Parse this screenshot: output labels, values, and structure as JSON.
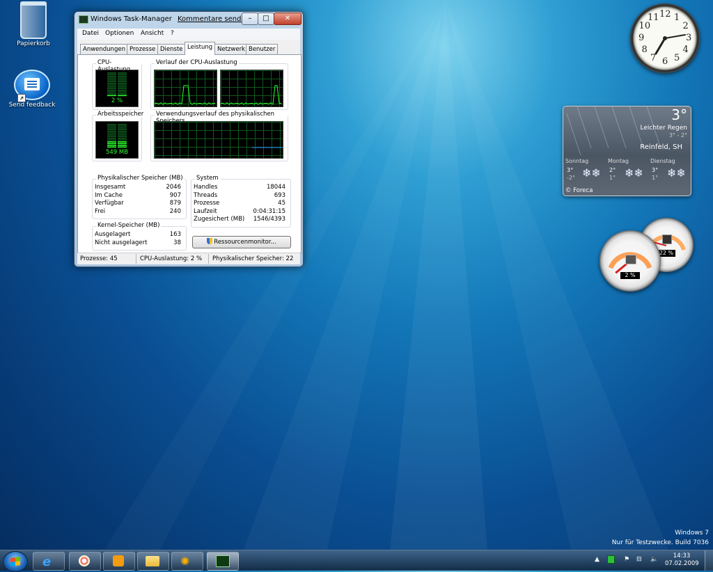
{
  "desktop": {
    "icons": [
      {
        "label": "Papierkorb"
      },
      {
        "label": "Send feedback"
      }
    ],
    "watermark": {
      "line1": "Windows 7",
      "line2": "Nur für Testzwecke. Build 7036"
    }
  },
  "task_manager": {
    "title": "Windows Task-Manager",
    "feedback_link": "Kommentare senden",
    "window_buttons": {
      "minimize": "–",
      "maximize": "□",
      "close": "✕"
    },
    "menu": [
      "Datei",
      "Optionen",
      "Ansicht",
      "?"
    ],
    "tabs": [
      "Anwendungen",
      "Prozesse",
      "Dienste",
      "Leistung",
      "Netzwerk",
      "Benutzer"
    ],
    "active_tab": "Leistung",
    "cpu_usage": {
      "label": "CPU-Auslastung",
      "value": "2 %",
      "fill": 0.02
    },
    "cpu_history_label": "Verlauf der CPU-Auslastung",
    "memory": {
      "label": "Arbeitsspeicher",
      "value": "549 MB",
      "fill": 0.27
    },
    "memory_history_label": "Verwendungsverlauf des physikalischen Speichers",
    "physical_memory": {
      "title": "Physikalischer Speicher (MB)",
      "rows": [
        {
          "key": "Insgesamt",
          "value": "2046"
        },
        {
          "key": "Im Cache",
          "value": "907"
        },
        {
          "key": "Verfügbar",
          "value": "879"
        },
        {
          "key": "Frei",
          "value": "240"
        }
      ]
    },
    "system": {
      "title": "System",
      "rows": [
        {
          "key": "Handles",
          "value": "18044"
        },
        {
          "key": "Threads",
          "value": "693"
        },
        {
          "key": "Prozesse",
          "value": "45"
        },
        {
          "key": "Laufzeit",
          "value": "0:04:31:15"
        },
        {
          "key": "Zugesichert (MB)",
          "value": "1546/4393"
        }
      ]
    },
    "kernel_memory": {
      "title": "Kernel-Speicher (MB)",
      "rows": [
        {
          "key": "Ausgelagert",
          "value": "163"
        },
        {
          "key": "Nicht ausgelagert",
          "value": "38"
        }
      ]
    },
    "resource_monitor_button": "Ressourcenmonitor...",
    "status": {
      "processes": "Prozesse: 45",
      "cpu": "CPU-Auslastung: 2 %",
      "memory": "Physikalischer Speicher: 22"
    }
  },
  "clock_gadget": {
    "numbers": [
      "12",
      "1",
      "2",
      "3",
      "4",
      "5",
      "6",
      "7",
      "8",
      "9",
      "10",
      "11"
    ],
    "time": "14:33"
  },
  "weather_gadget": {
    "temperature": "3°",
    "condition": "Leichter Regen",
    "range": "3° - 2°",
    "location": "Reinfeld, SH",
    "forecast": [
      {
        "day": "Sonntag",
        "high": "3°",
        "low": "-2°"
      },
      {
        "day": "Montag",
        "high": "2°",
        "low": "1°"
      },
      {
        "day": "Dienstag",
        "high": "3°",
        "low": "1°"
      }
    ],
    "credit": "© Foreca"
  },
  "meter_gadget": {
    "cpu": "2 %",
    "cpu_level": 0.02,
    "memory": "22 %",
    "memory_level": 0.22
  },
  "taskbar": {
    "pinned": [
      "internet-explorer-icon",
      "paint-icon",
      "media-player-icon",
      "explorer-icon",
      "messenger-icon",
      "task-manager-icon"
    ],
    "tray_clock": {
      "time": "14:33",
      "date": "07.02.2009"
    }
  },
  "colors": {
    "graph_line": "#2cff2c",
    "graph_grid": "#0f5a1e",
    "memory_line": "#1e90ff"
  }
}
